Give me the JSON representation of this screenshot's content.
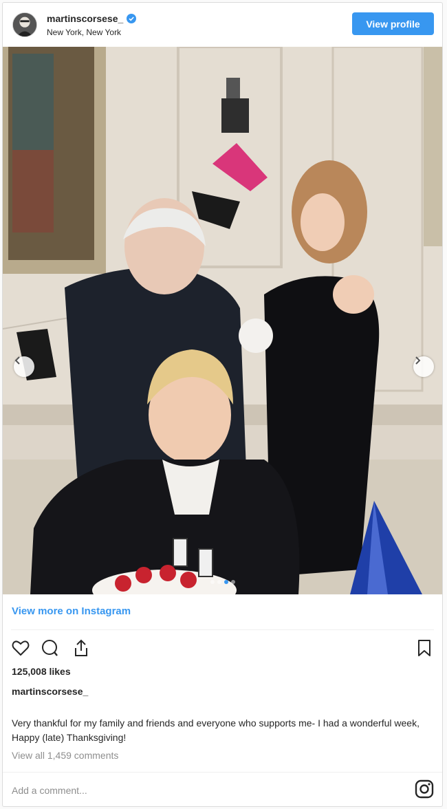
{
  "header": {
    "username": "martinscorsese_",
    "location": "New York, New York",
    "view_profile_label": "View profile",
    "verified_icon": "verified-badge-icon"
  },
  "carousel": {
    "prev_icon": "chevron-left-icon",
    "next_icon": "chevron-right-icon",
    "slide_count": 4,
    "active_slide": 3
  },
  "post": {
    "view_more_label": "View more on Instagram",
    "likes": "125,008 likes",
    "author": "martinscorsese_",
    "caption": "Very thankful for my family and friends and everyone who supports me- I had a wonderful week, Happy (late) Thanksgiving!",
    "view_all_comments": "View all 1,459 comments",
    "add_comment_placeholder": "Add a comment..."
  },
  "icons": {
    "like": "heart-icon",
    "comment": "comment-icon",
    "share": "share-icon",
    "save": "bookmark-icon",
    "instagram": "instagram-logo-icon"
  },
  "colors": {
    "accent": "#3897f0",
    "text": "#262626",
    "muted": "#8e8e8e",
    "border": "#dbdbdb"
  }
}
